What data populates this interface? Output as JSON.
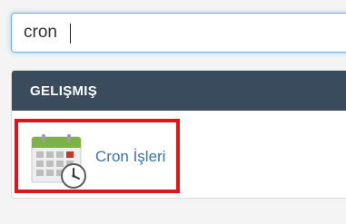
{
  "search": {
    "value": "cron"
  },
  "section": {
    "title": "GELIŞMIŞ"
  },
  "items": [
    {
      "label": "Cron İşleri",
      "icon": "calendar-clock-icon"
    }
  ],
  "colors": {
    "header_bg": "#3b4b5e",
    "link": "#3b73a8",
    "highlight_border": "#e0151b",
    "focus_border": "#66afe9",
    "calendar_header": "#7cb342",
    "calendar_marked_cell": "#c0392b"
  }
}
